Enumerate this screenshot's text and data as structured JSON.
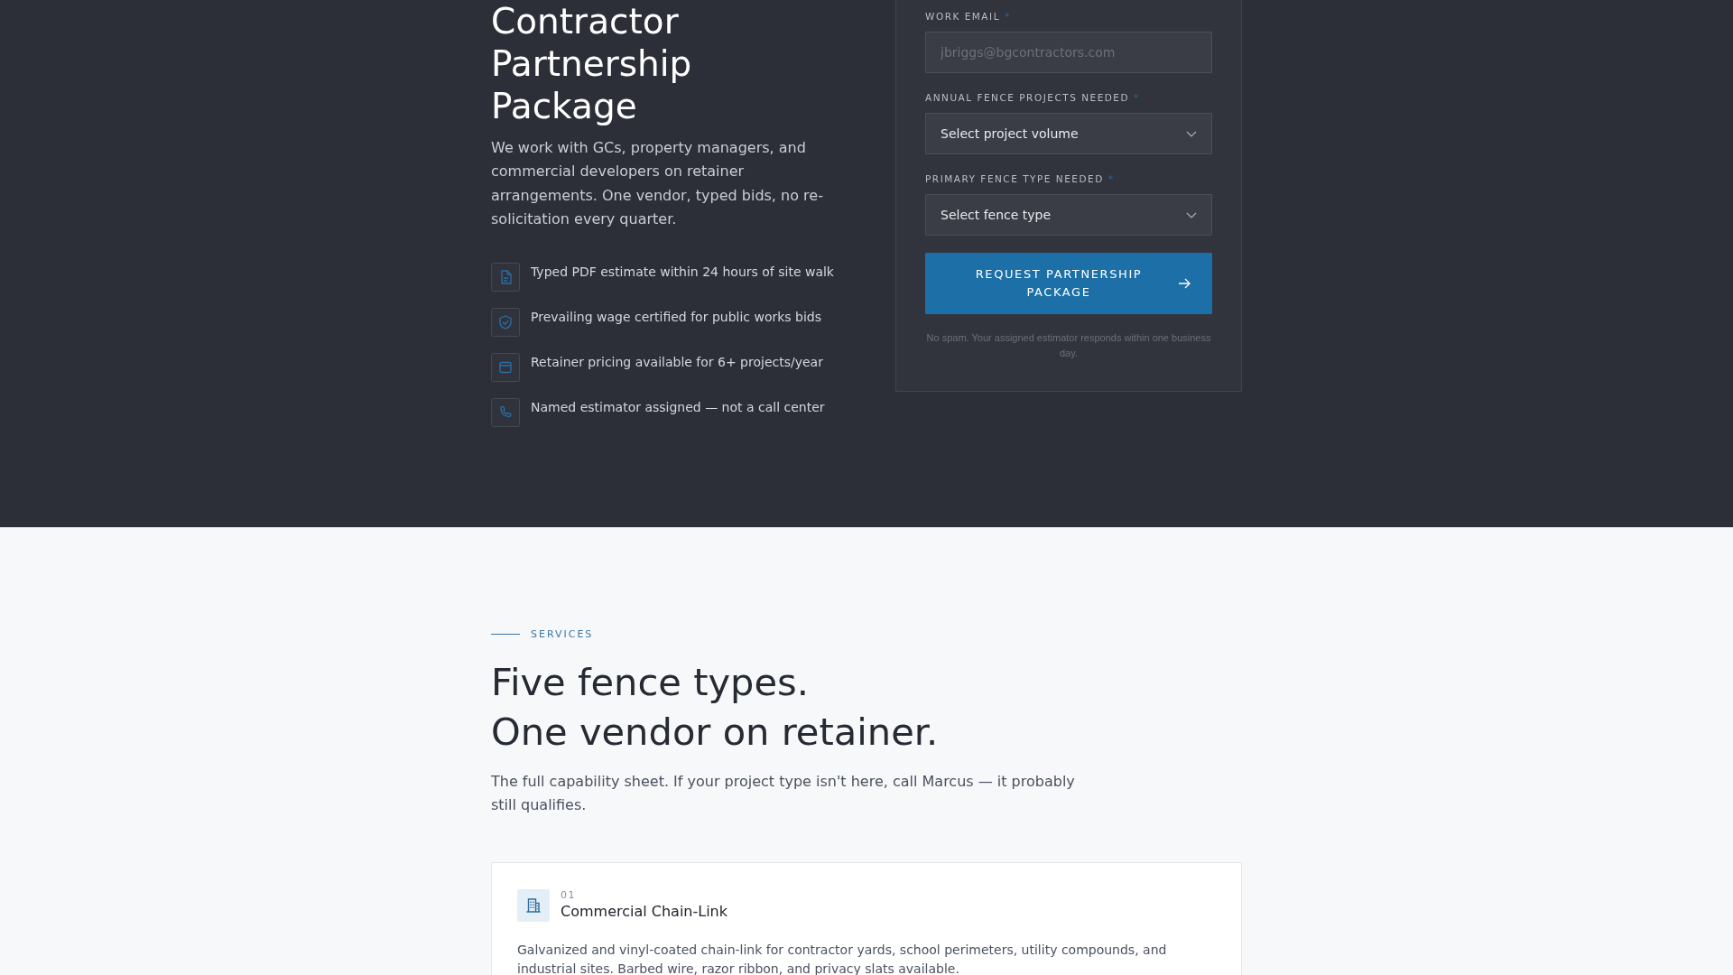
{
  "hero": {
    "title": "Contractor Partnership Package",
    "description": "We work with GCs, property managers, and commercial developers on retainer arrangements. One vendor, typed bids, no re-solicitation every quarter.",
    "features": [
      {
        "text": "Typed PDF estimate within 24 hours of site walk"
      },
      {
        "text": "Prevailing wage certified for public works bids"
      },
      {
        "text": "Retainer pricing available for 6+ projects/year"
      },
      {
        "text": "Named estimator assigned — not a call center"
      }
    ]
  },
  "form": {
    "fields": [
      {
        "kind": "input",
        "label": "WORK EMAIL",
        "required_mark": "*",
        "placeholder": "jbriggs@bgcontractors.com"
      },
      {
        "kind": "select",
        "label": "ANNUAL FENCE PROJECTS NEEDED",
        "required_mark": "*",
        "value": "Select project volume"
      },
      {
        "kind": "select",
        "label": "PRIMARY FENCE TYPE NEEDED",
        "required_mark": "*",
        "value": "Select fence type"
      }
    ],
    "submit": {
      "label": "REQUEST PARTNERSHIP PACKAGE"
    },
    "note": "No spam. Your assigned estimator responds within one business day."
  },
  "services": {
    "eyebrow": "SERVICES",
    "heading_lines": [
      "Five fence types.",
      "One vendor on retainer."
    ],
    "intro": "The full capability sheet. If your project type isn't here, call Marcus — it probably still qualifies.",
    "cards": [
      {
        "number": "01",
        "title": "Commercial Chain-Link",
        "description": "Galvanized and vinyl-coated chain-link for contractor yards, school perimeters, utility compounds, and industrial sites. Barbed wire, razor ribbon, and privacy slats available."
      }
    ]
  }
}
